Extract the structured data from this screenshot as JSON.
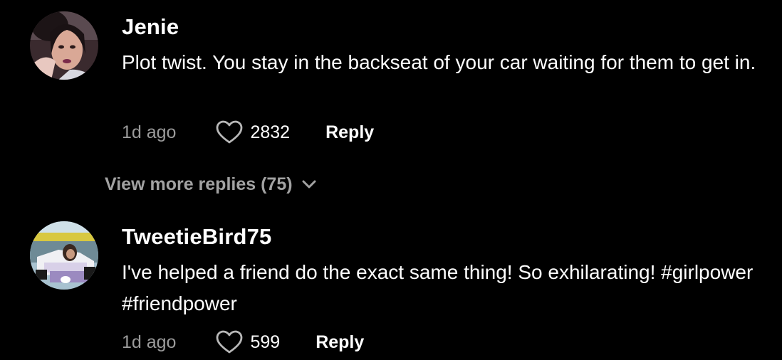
{
  "comments": [
    {
      "username": "Jenie",
      "text": "Plot twist. You stay in the backseat of your car waiting for them to get in.",
      "time": "1d ago",
      "likes": "2832",
      "reply_label": "Reply",
      "avatar_icon": "profile-photo-woman"
    },
    {
      "username": "TweetieBird75",
      "text": "I've helped a friend do the exact same thing! So exhilarating! #girlpower #friendpower",
      "time": "1d ago",
      "likes": "599",
      "reply_label": "Reply",
      "avatar_icon": "profile-photo-race-car"
    }
  ],
  "view_more_replies": "View more replies (75)",
  "colors": {
    "background": "#000000",
    "text": "#ffffff",
    "muted": "#9b9b9b"
  },
  "icons": {
    "like": "heart-outline-icon",
    "expand": "chevron-down-icon"
  }
}
